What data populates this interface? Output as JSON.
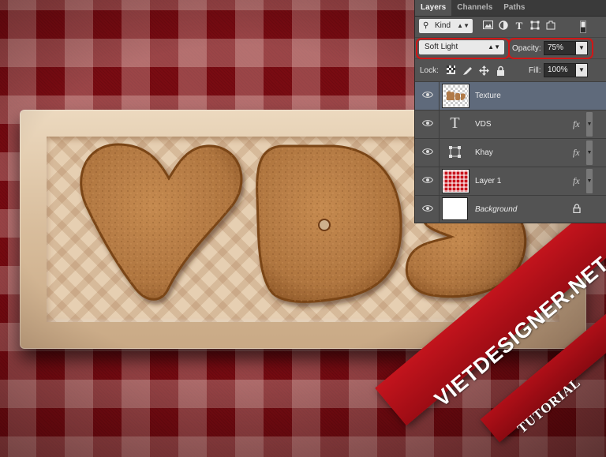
{
  "panel": {
    "tabs": [
      "Layers",
      "Channels",
      "Paths"
    ],
    "filter": {
      "kind_label": "Kind",
      "search_icon": "search-icon"
    },
    "blend_mode": "Soft Light",
    "opacity_label": "Opacity:",
    "opacity_value": "75%",
    "lock_label": "Lock:",
    "fill_label": "Fill:",
    "fill_value": "100%",
    "layers": [
      {
        "name": "Texture",
        "type": "image",
        "selected": true,
        "fx": false
      },
      {
        "name": "VDS",
        "type": "text",
        "selected": false,
        "fx": true,
        "fx_label": "fx"
      },
      {
        "name": "Khay",
        "type": "shape",
        "selected": false,
        "fx": true,
        "fx_label": "fx"
      },
      {
        "name": "Layer 1",
        "type": "pattern",
        "selected": false,
        "fx": true,
        "fx_label": "fx"
      },
      {
        "name": "Background",
        "type": "background",
        "selected": false,
        "fx": false,
        "locked": true
      }
    ]
  },
  "artwork": {
    "cookie_text": "VDS",
    "watermark_brand": "VIETDESIGNER.NET",
    "watermark_subtitle": "TUTORIAL"
  },
  "colors": {
    "highlight_ring": "#d11616",
    "cookie": "#b77d45",
    "tablecloth": "#7a0b12",
    "selected_layer": "#5f6a7b"
  }
}
